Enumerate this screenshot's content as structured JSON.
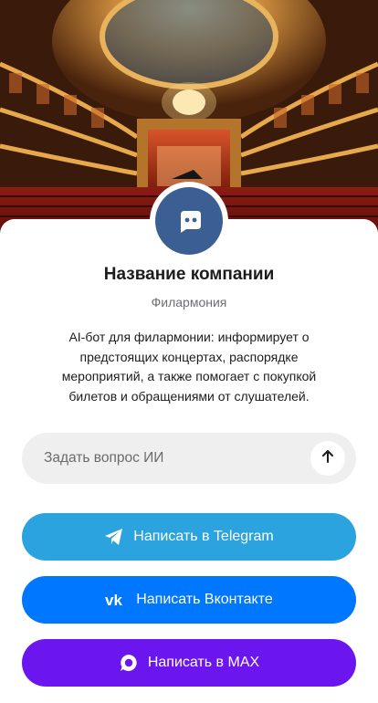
{
  "company": {
    "name": "Название компании",
    "type": "Филармония",
    "description": "AI-бот для филармонии: информирует о предстоящих концертах, распорядке мероприятий, а также помогает с покупкой билетов и обращениями от слушателей."
  },
  "ask": {
    "placeholder": "Задать вопрос ИИ",
    "send_icon": "arrow-up-icon"
  },
  "buttons": [
    {
      "label": "Написать в Telegram",
      "icon": "telegram-icon",
      "color": "#2aa3df"
    },
    {
      "label": "Написать Вконтакте",
      "icon": "vk-icon",
      "color": "#0077ff"
    },
    {
      "label": "Написать в MAX",
      "icon": "max-icon",
      "color": "#6b16ee"
    }
  ],
  "colors": {
    "avatar": "#3b5f93",
    "ask_background": "#efefef"
  }
}
